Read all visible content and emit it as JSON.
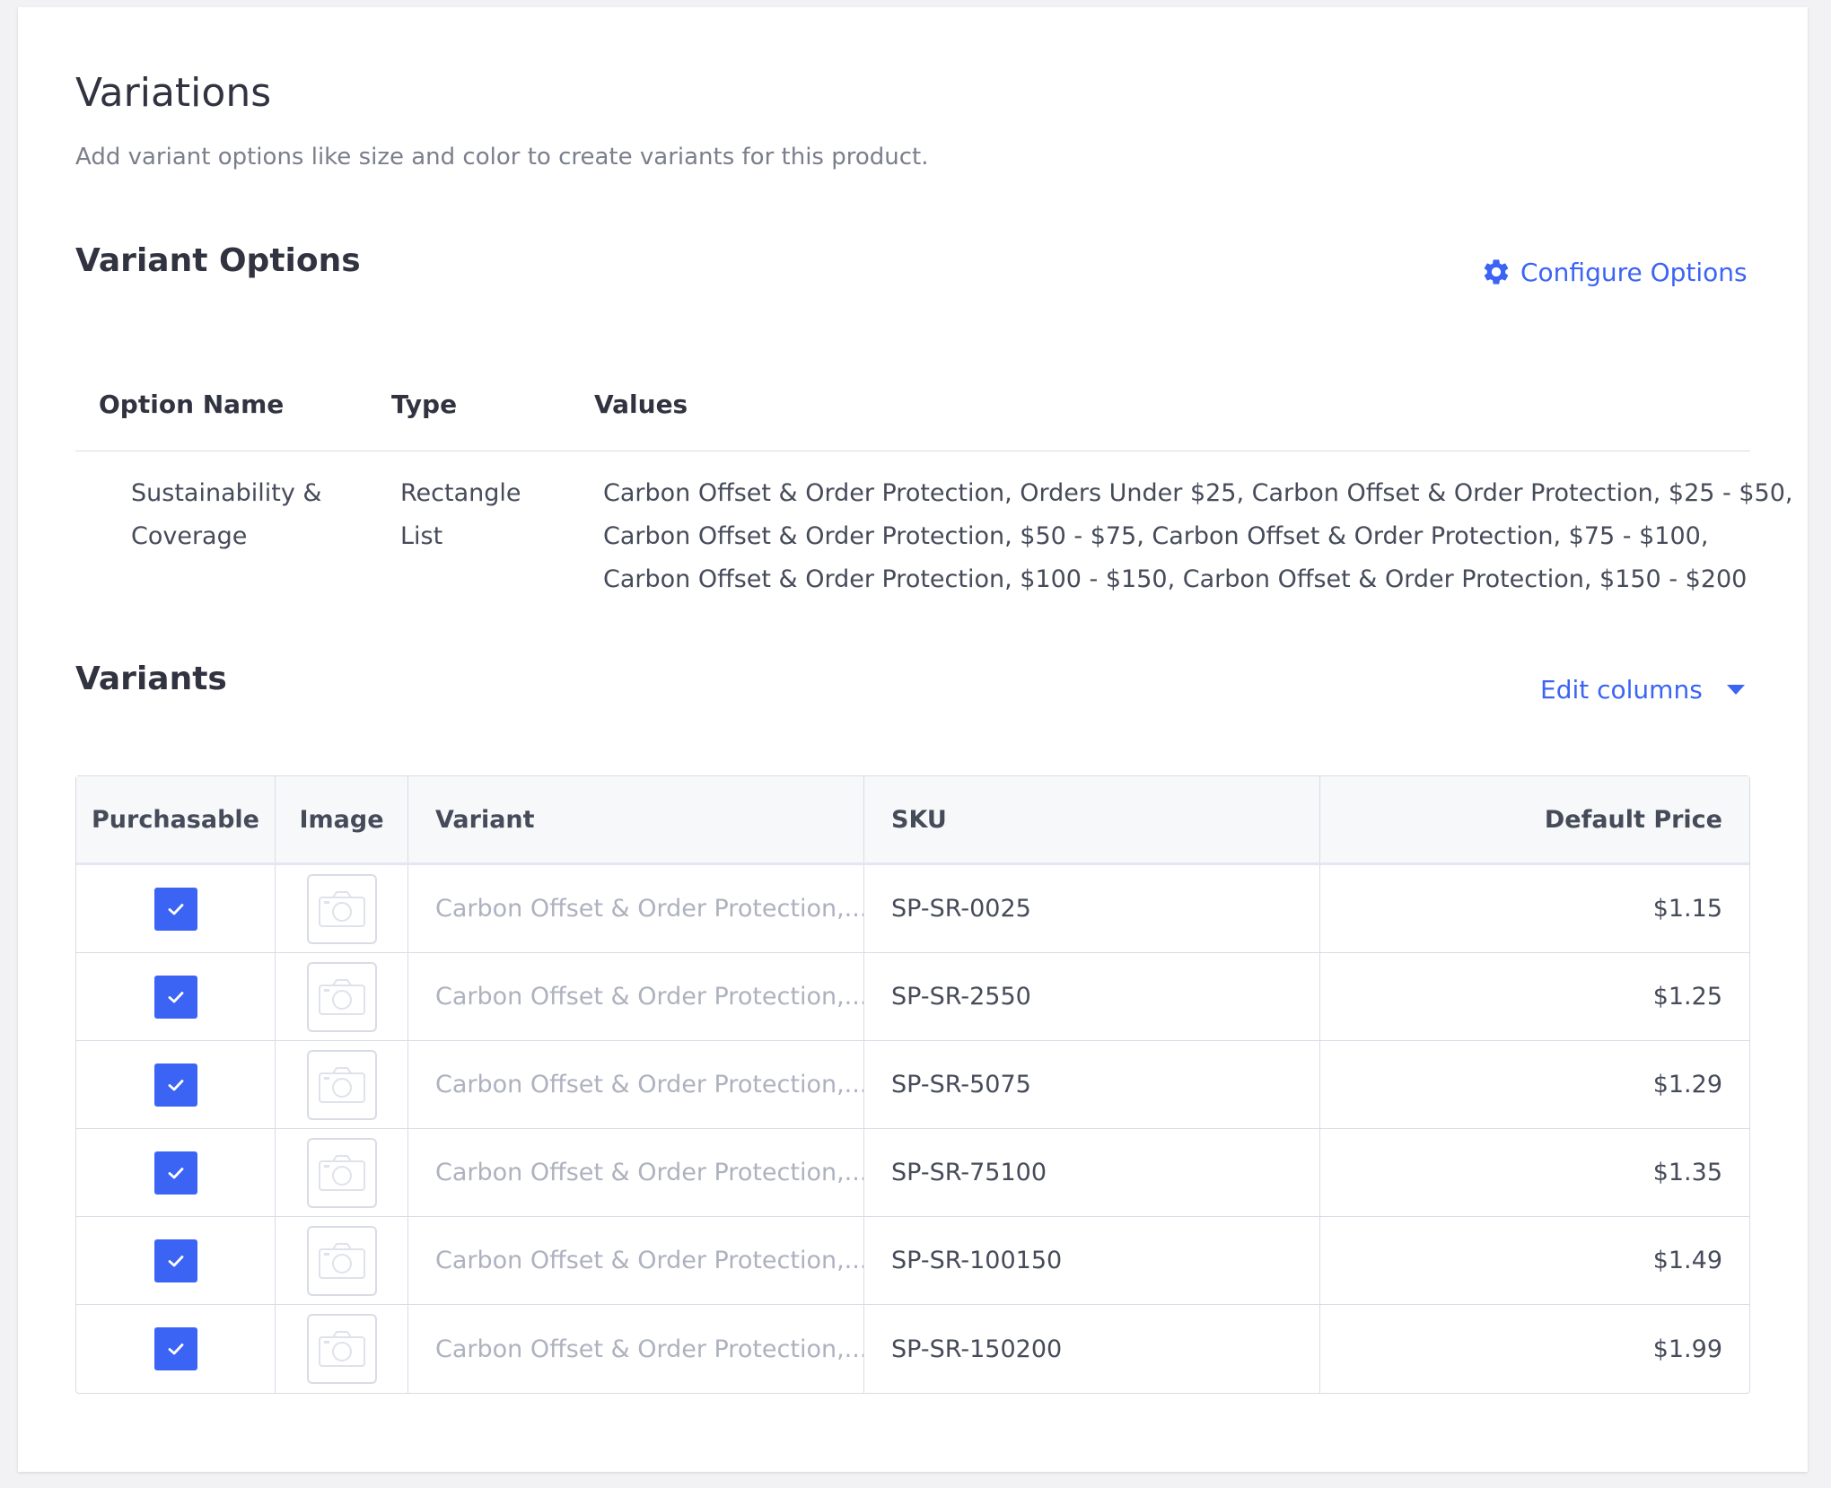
{
  "header": {
    "title": "Variations",
    "subtitle": "Add variant options like size and color to create variants for this product."
  },
  "variant_options": {
    "title": "Variant Options",
    "configure_label": "Configure Options",
    "columns": {
      "name": "Option Name",
      "type": "Type",
      "values": "Values"
    },
    "row": {
      "name_line1": "Sustainability &",
      "name_line2": "Coverage",
      "type_line1": "Rectangle",
      "type_line2": "List",
      "values_line1": "Carbon Offset & Order Protection, Orders Under $25, Carbon Offset & Order Protection, $25 - $50,",
      "values_line2": "Carbon Offset & Order Protection, $50 - $75, Carbon Offset & Order Protection, $75 - $100,",
      "values_line3": "Carbon Offset & Order Protection, $100 - $150, Carbon Offset & Order Protection, $150 - $200"
    }
  },
  "variants": {
    "title": "Variants",
    "edit_columns_label": "Edit columns",
    "columns": {
      "purchasable": "Purchasable",
      "image": "Image",
      "variant": "Variant",
      "sku": "SKU",
      "price": "Default Price"
    },
    "rows": [
      {
        "variant": "Carbon Offset & Order Protection,...",
        "sku": "SP-SR-0025",
        "price": "$1.15"
      },
      {
        "variant": "Carbon Offset & Order Protection,...",
        "sku": "SP-SR-2550",
        "price": "$1.25"
      },
      {
        "variant": "Carbon Offset & Order Protection,...",
        "sku": "SP-SR-5075",
        "price": "$1.29"
      },
      {
        "variant": "Carbon Offset & Order Protection,...",
        "sku": "SP-SR-75100",
        "price": "$1.35"
      },
      {
        "variant": "Carbon Offset & Order Protection,...",
        "sku": "SP-SR-100150",
        "price": "$1.49"
      },
      {
        "variant": "Carbon Offset & Order Protection,...",
        "sku": "SP-SR-150200",
        "price": "$1.99"
      }
    ]
  },
  "colors": {
    "accent": "#3c64f4",
    "text": "#313440",
    "muted": "#7b7f8c",
    "border": "#d9dce6"
  },
  "icons": {
    "configure": "gear-icon",
    "edit_columns": "caret-down-icon",
    "checkbox": "checkmark-icon",
    "image": "camera-icon"
  }
}
